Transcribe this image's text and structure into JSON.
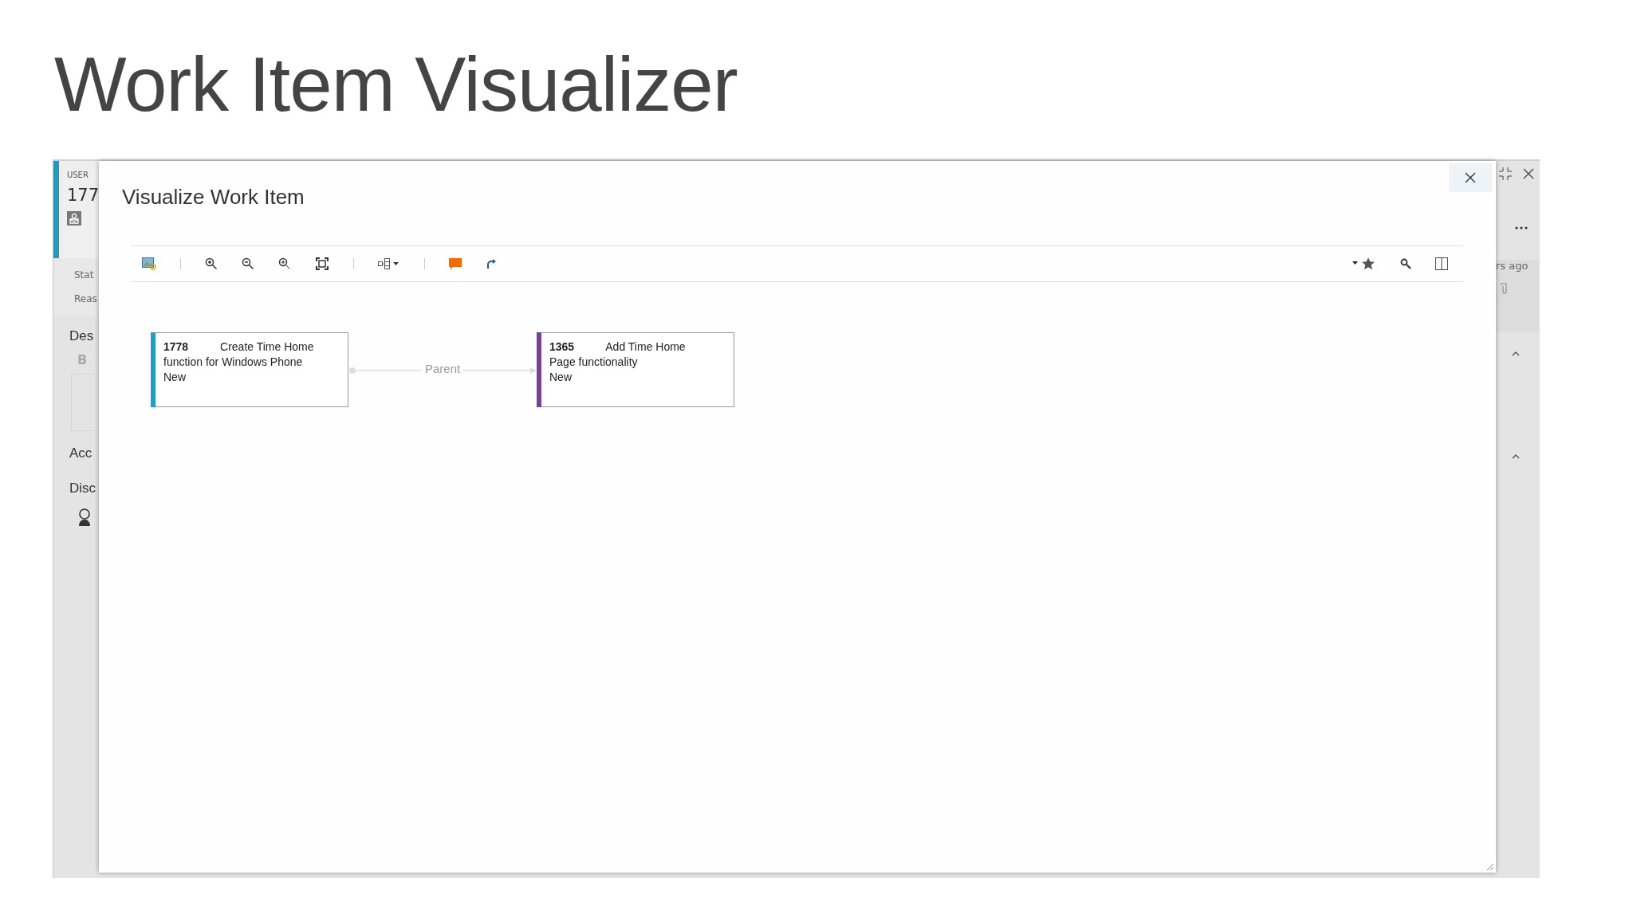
{
  "slide_title": "Work Item Visualizer",
  "background_form": {
    "type_label": "USER",
    "id": "177",
    "fields": [
      "Stat",
      "Reas"
    ],
    "sections": [
      "Des",
      "Acc",
      "Disc"
    ],
    "bold_button": "B",
    "timestamp": "rs ago"
  },
  "dialog": {
    "title": "Visualize Work Item",
    "nodes": [
      {
        "id": "1778",
        "title": "Create Time Home function for Windows Phone",
        "state": "New",
        "color": "#1ba1c9"
      },
      {
        "id": "1365",
        "title": "Add Time Home Page functionality",
        "state": "New",
        "color": "#7a3f98"
      }
    ],
    "links": [
      {
        "label": "Parent"
      }
    ]
  }
}
